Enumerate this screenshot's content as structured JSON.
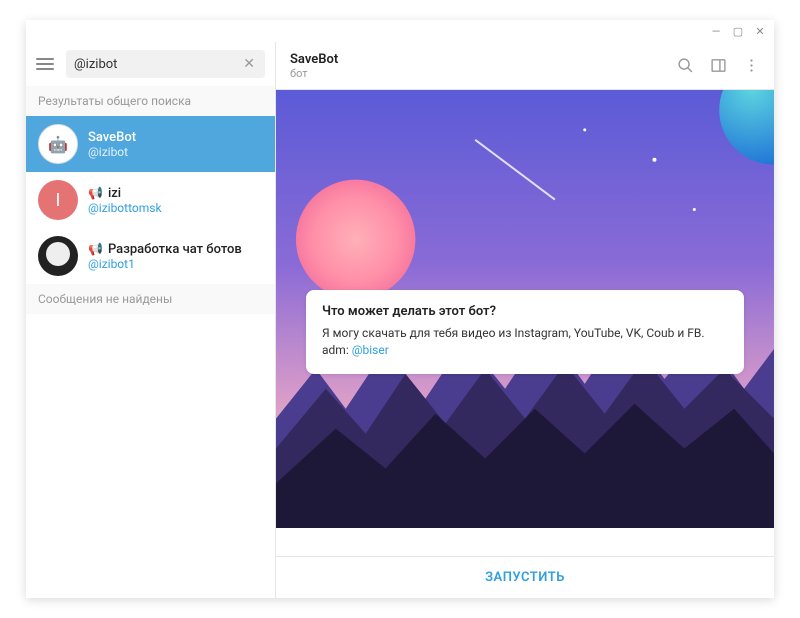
{
  "search": {
    "value": "@izibot"
  },
  "sidebar": {
    "section_label": "Результаты общего поиска",
    "no_messages": "Сообщения не найдены",
    "items": [
      {
        "title": "SaveBot",
        "handle": "@izibot"
      },
      {
        "title": "izi",
        "handle": "@izibottomsk"
      },
      {
        "title": "Разработка чат ботов",
        "handle": "@izibot1"
      }
    ]
  },
  "chat": {
    "title": "SaveBot",
    "subtitle": "бот",
    "card_title": "Что может делать этот бот?",
    "card_body_prefix": "Я могу скачать для тебя видео из Instagram, YouTube, VK, Coub и FB. adm: ",
    "card_link": "@biser",
    "start_button": "ЗАПУСТИТЬ"
  }
}
